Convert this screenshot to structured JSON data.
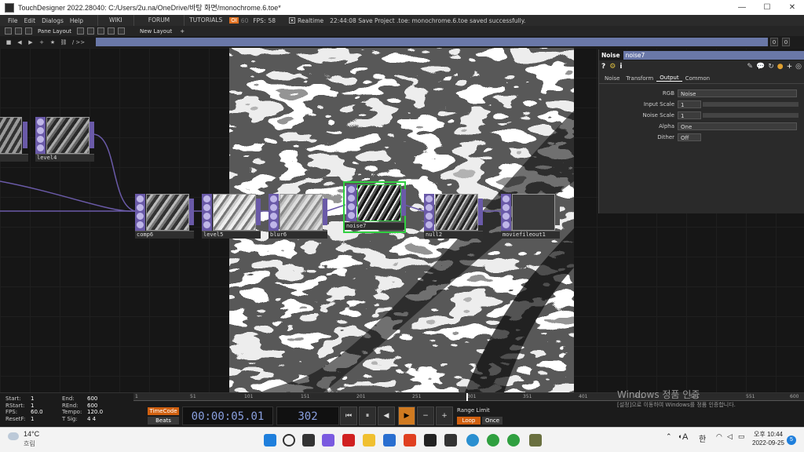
{
  "window": {
    "title": "TouchDesigner 2022.28040: C:/Users/2u.na/OneDrive/바탕 화면/monochrome.6.toe*",
    "minimize": "—",
    "maximize": "☐",
    "close": "✕"
  },
  "menubar": {
    "items": [
      "File",
      "Edit",
      "Dialogs",
      "Help"
    ],
    "tabs": [
      "WIKI",
      "FORUM",
      "TUTORIALS"
    ],
    "oi_badge": "OI",
    "fps_cap": "60",
    "fps_label": "FPS:",
    "fps_value": "58",
    "realtime_label": "Realtime",
    "status_message": "22:44:08 Save Project .toe: monochrome.6.toe saved successfully."
  },
  "panebar": {
    "pane_layout": "Pane Layout",
    "new_layout": "New Layout",
    "add": "+"
  },
  "pathbar": {
    "path_prefix": "/ >>",
    "num_left": "0",
    "num_right": "0"
  },
  "nodes": [
    {
      "name": "level4",
      "label": ""
    },
    {
      "name": "level4b",
      "label": "level4"
    },
    {
      "name": "comp6",
      "label": "comp6"
    },
    {
      "name": "level5",
      "label": "level5"
    },
    {
      "name": "blur6",
      "label": "blur6"
    },
    {
      "name": "noise7",
      "label": "noise7"
    },
    {
      "name": "null2",
      "label": "null2"
    },
    {
      "name": "moviefileout1",
      "label": "moviefileout1"
    }
  ],
  "param_panel": {
    "op_type": "Noise",
    "op_name": "noise7",
    "tabs": [
      "Noise",
      "Transform",
      "Output",
      "Common"
    ],
    "active_tab": "Output",
    "params": [
      {
        "label": "RGB",
        "value": "Noise"
      },
      {
        "label": "Input Scale",
        "value": "1"
      },
      {
        "label": "Noise Scale",
        "value": "1"
      },
      {
        "label": "Alpha",
        "value": "One"
      },
      {
        "label": "Dither",
        "value": "Off"
      }
    ]
  },
  "timeline": {
    "stats": [
      {
        "k": "Start:",
        "v": "1",
        "k2": "End:",
        "v2": "600"
      },
      {
        "k": "RStart:",
        "v": "1",
        "k2": "REnd:",
        "v2": "600"
      },
      {
        "k": "FPS:",
        "v": "60.0",
        "k2": "Tempo:",
        "v2": "120.0"
      },
      {
        "k": "ResetF:",
        "v": "1",
        "k2": "T Sig:",
        "v2": "4     4"
      }
    ],
    "ruler_ticks": [
      "1",
      "51",
      "101",
      "151",
      "201",
      "251",
      "301",
      "351",
      "401",
      "451",
      "501",
      "551",
      "600"
    ],
    "timecode_label": "TimeCode",
    "beats_label": "Beats",
    "clock": "00:00:05.01",
    "frame": "302",
    "range_limit": "Range Limit",
    "loop": "Loop",
    "once": "Once",
    "transport": [
      "⏮",
      "⏸",
      "◀",
      "▶",
      "−",
      "+"
    ]
  },
  "activation": {
    "title": "Windows 정품 인증",
    "subtitle": "[설정]으로 이동하여 Windows를 정품 인증합니다."
  },
  "taskbar": {
    "weather_temp": "14°C",
    "weather_desc": "흐림",
    "ime_a": "A",
    "ime_han": "한",
    "time": "오후 10:44",
    "date": "2022-09-25",
    "notif": "5"
  }
}
